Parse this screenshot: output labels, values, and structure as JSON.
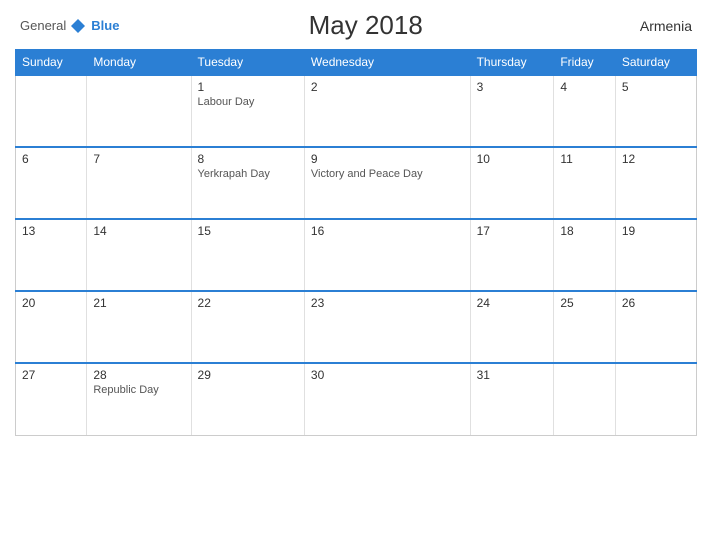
{
  "header": {
    "logo_general": "General",
    "logo_blue": "Blue",
    "title": "May 2018",
    "country": "Armenia"
  },
  "days_of_week": [
    "Sunday",
    "Monday",
    "Tuesday",
    "Wednesday",
    "Thursday",
    "Friday",
    "Saturday"
  ],
  "weeks": [
    [
      {
        "day": "",
        "holiday": ""
      },
      {
        "day": "",
        "holiday": ""
      },
      {
        "day": "1",
        "holiday": "Labour Day"
      },
      {
        "day": "2",
        "holiday": ""
      },
      {
        "day": "3",
        "holiday": ""
      },
      {
        "day": "4",
        "holiday": ""
      },
      {
        "day": "5",
        "holiday": ""
      }
    ],
    [
      {
        "day": "6",
        "holiday": ""
      },
      {
        "day": "7",
        "holiday": ""
      },
      {
        "day": "8",
        "holiday": "Yerkrapah Day"
      },
      {
        "day": "9",
        "holiday": "Victory and Peace Day"
      },
      {
        "day": "10",
        "holiday": ""
      },
      {
        "day": "11",
        "holiday": ""
      },
      {
        "day": "12",
        "holiday": ""
      }
    ],
    [
      {
        "day": "13",
        "holiday": ""
      },
      {
        "day": "14",
        "holiday": ""
      },
      {
        "day": "15",
        "holiday": ""
      },
      {
        "day": "16",
        "holiday": ""
      },
      {
        "day": "17",
        "holiday": ""
      },
      {
        "day": "18",
        "holiday": ""
      },
      {
        "day": "19",
        "holiday": ""
      }
    ],
    [
      {
        "day": "20",
        "holiday": ""
      },
      {
        "day": "21",
        "holiday": ""
      },
      {
        "day": "22",
        "holiday": ""
      },
      {
        "day": "23",
        "holiday": ""
      },
      {
        "day": "24",
        "holiday": ""
      },
      {
        "day": "25",
        "holiday": ""
      },
      {
        "day": "26",
        "holiday": ""
      }
    ],
    [
      {
        "day": "27",
        "holiday": ""
      },
      {
        "day": "28",
        "holiday": "Republic Day"
      },
      {
        "day": "29",
        "holiday": ""
      },
      {
        "day": "30",
        "holiday": ""
      },
      {
        "day": "31",
        "holiday": ""
      },
      {
        "day": "",
        "holiday": ""
      },
      {
        "day": "",
        "holiday": ""
      }
    ]
  ]
}
